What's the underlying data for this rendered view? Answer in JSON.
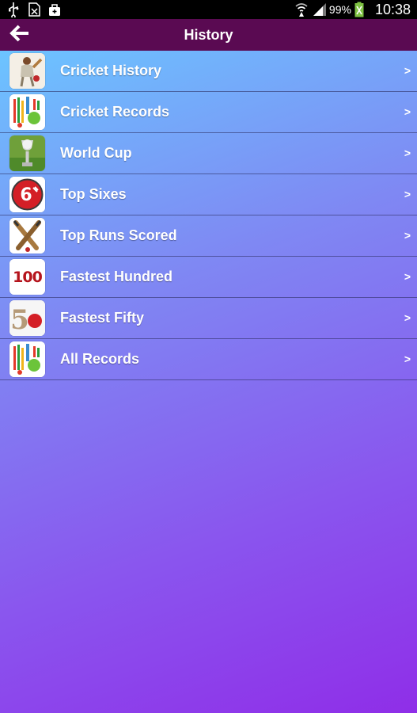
{
  "status_bar": {
    "battery": "99%",
    "time": "10:38",
    "icons": [
      "usb-icon",
      "sim-missing-icon",
      "bag-icon",
      "wifi-icon",
      "signal-icon",
      "battery-icon"
    ]
  },
  "header": {
    "title": "History",
    "back_icon": "back-arrow-icon",
    "background": "#5a0a52"
  },
  "list": {
    "items": [
      {
        "label": "Cricket History",
        "icon": "cricket-history-icon"
      },
      {
        "label": "Cricket Records",
        "icon": "cricket-records-icon"
      },
      {
        "label": "World Cup",
        "icon": "world-cup-icon"
      },
      {
        "label": "Top Sixes",
        "icon": "top-sixes-icon"
      },
      {
        "label": "Top Runs Scored",
        "icon": "crossed-bats-icon"
      },
      {
        "label": "Fastest Hundred",
        "icon": "fastest-hundred-icon"
      },
      {
        "label": "Fastest Fifty",
        "icon": "fastest-fifty-icon"
      },
      {
        "label": "All Records",
        "icon": "all-records-icon"
      }
    ],
    "chevron": ">",
    "hundred_icon_text": "100",
    "fifty_icon_text": "5",
    "sixes_icon_text": "6"
  },
  "colors": {
    "gradient_top": "#6cc4ff",
    "gradient_bottom": "#8f2ee8"
  }
}
